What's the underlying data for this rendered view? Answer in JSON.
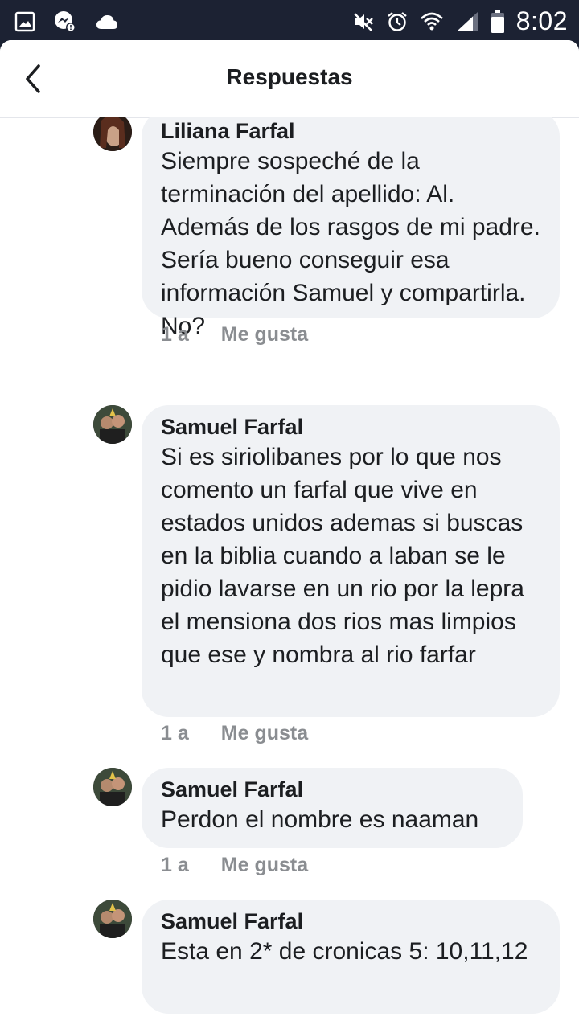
{
  "status_bar": {
    "time": "8:02",
    "left_icons": [
      "image-icon",
      "messenger-icon",
      "cloud-icon"
    ],
    "right_icons": [
      "mute-icon",
      "alarm-icon",
      "wifi-icon",
      "signal-icon",
      "battery-icon"
    ]
  },
  "header": {
    "title": "Respuestas",
    "back_icon": "chevron-left-icon"
  },
  "comments": [
    {
      "author": "Liliana Farfal",
      "text": "Siempre sospeché de la terminación del apellido: Al. Además de los rasgos de mi padre. Sería bueno conseguir esa información Samuel y compartirla. No?",
      "time": "1 a",
      "like_label": "Me gusta"
    },
    {
      "author": "Samuel Farfal",
      "text": "Si es siriolibanes por lo que nos comento un farfal que vive en estados unidos ademas si buscas en la biblia cuando a laban se le pidio lavarse en un rio por la lepra el mensiona dos rios mas limpios que ese y nombra al rio farfar",
      "time": "1 a",
      "like_label": "Me gusta"
    },
    {
      "author": "Samuel Farfal",
      "text": "Perdon el nombre es naaman",
      "time": "1 a",
      "like_label": "Me gusta"
    },
    {
      "author": "Samuel Farfal",
      "text": "Esta en 2* de cronicas 5: 10,11,12",
      "time": "",
      "like_label": ""
    }
  ],
  "colors": {
    "status_bar_bg": "#1c2233",
    "bubble_bg": "#f0f2f5",
    "meta_text": "#8a8d91"
  }
}
